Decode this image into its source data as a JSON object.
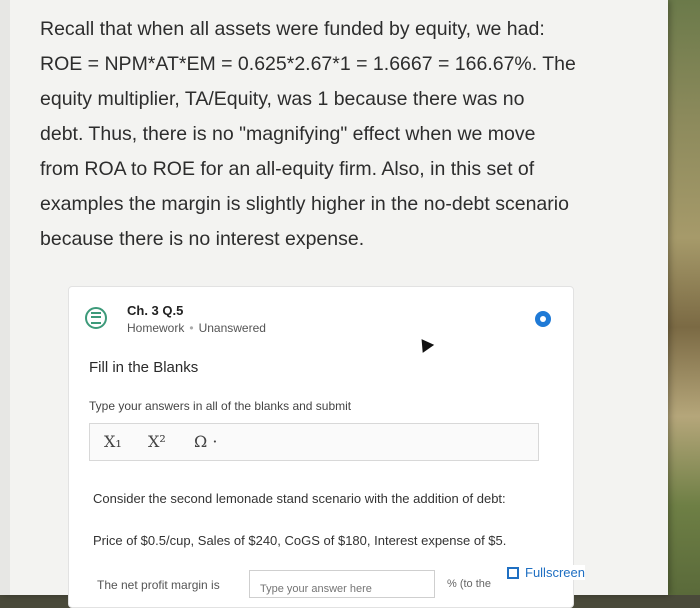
{
  "intro": {
    "line1": "Recall that when all assets were funded by equity, we had:",
    "line2": "ROE = NPM*AT*EM = 0.625*2.67*1 = 1.6667 = 166.67%.  The",
    "line3": "equity multiplier, TA/Equity, was 1 because there was no",
    "line4": "debt. Thus, there is no \"magnifying\" effect when we move",
    "line5": "from ROA to ROE for an all-equity firm. Also, in this set of",
    "line6": "examples the margin is slightly higher in the no-debt scenario",
    "line7": "because there is no interest expense."
  },
  "question": {
    "title": "Ch. 3 Q.5",
    "type": "Homework",
    "status": "Unanswered",
    "section": "Fill in the Blanks",
    "instructions": "Type your answers in all of the blanks and submit",
    "toolbar": {
      "subscript": "X₁",
      "superscript": "X²",
      "omega": "Ω ·"
    },
    "scenario": "Consider the second lemonade stand scenario with the addition of debt:",
    "details": "Price of $0.5/cup, Sales of $240, CoGS of $180, Interest expense of $5.",
    "answer_label": "The net profit margin is",
    "answer_placeholder": "Type your answer here",
    "answer_tail": "% (to the",
    "fullscreen_label": "Fullscreen"
  },
  "colors": {
    "accent": "#1f7ad6",
    "icon_green": "#3d9a7a"
  },
  "icons": [
    "question-list-icon",
    "status-dot-icon",
    "fullscreen-icon",
    "cursor-icon"
  ]
}
